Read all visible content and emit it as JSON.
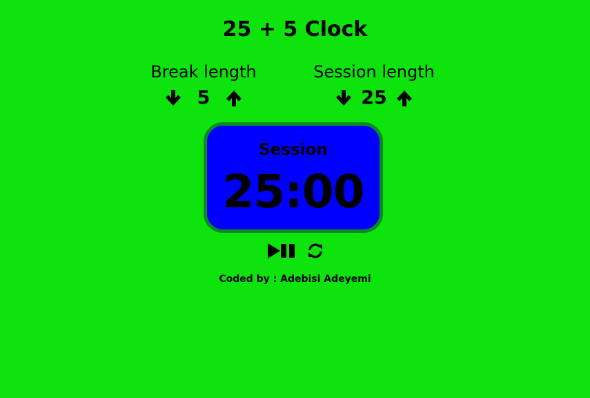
{
  "title": "25 + 5 Clock",
  "break": {
    "label": "Break length",
    "value": "5",
    "decrement_icon": "arrow-down-icon",
    "increment_icon": "arrow-up-icon"
  },
  "session": {
    "label": "Session length",
    "value": "25",
    "decrement_icon": "arrow-down-icon",
    "increment_icon": "arrow-up-icon"
  },
  "timer": {
    "label": "Session",
    "time": "25:00"
  },
  "controls": {
    "play_pause_icon": "play-pause-icon",
    "reset_icon": "refresh-icon"
  },
  "footer": "Coded by : Adebisi Adeyemi",
  "colors": {
    "background": "#0ce40c",
    "timer_background": "#0000ff",
    "timer_border": "#0b8a21",
    "text": "#000000"
  }
}
